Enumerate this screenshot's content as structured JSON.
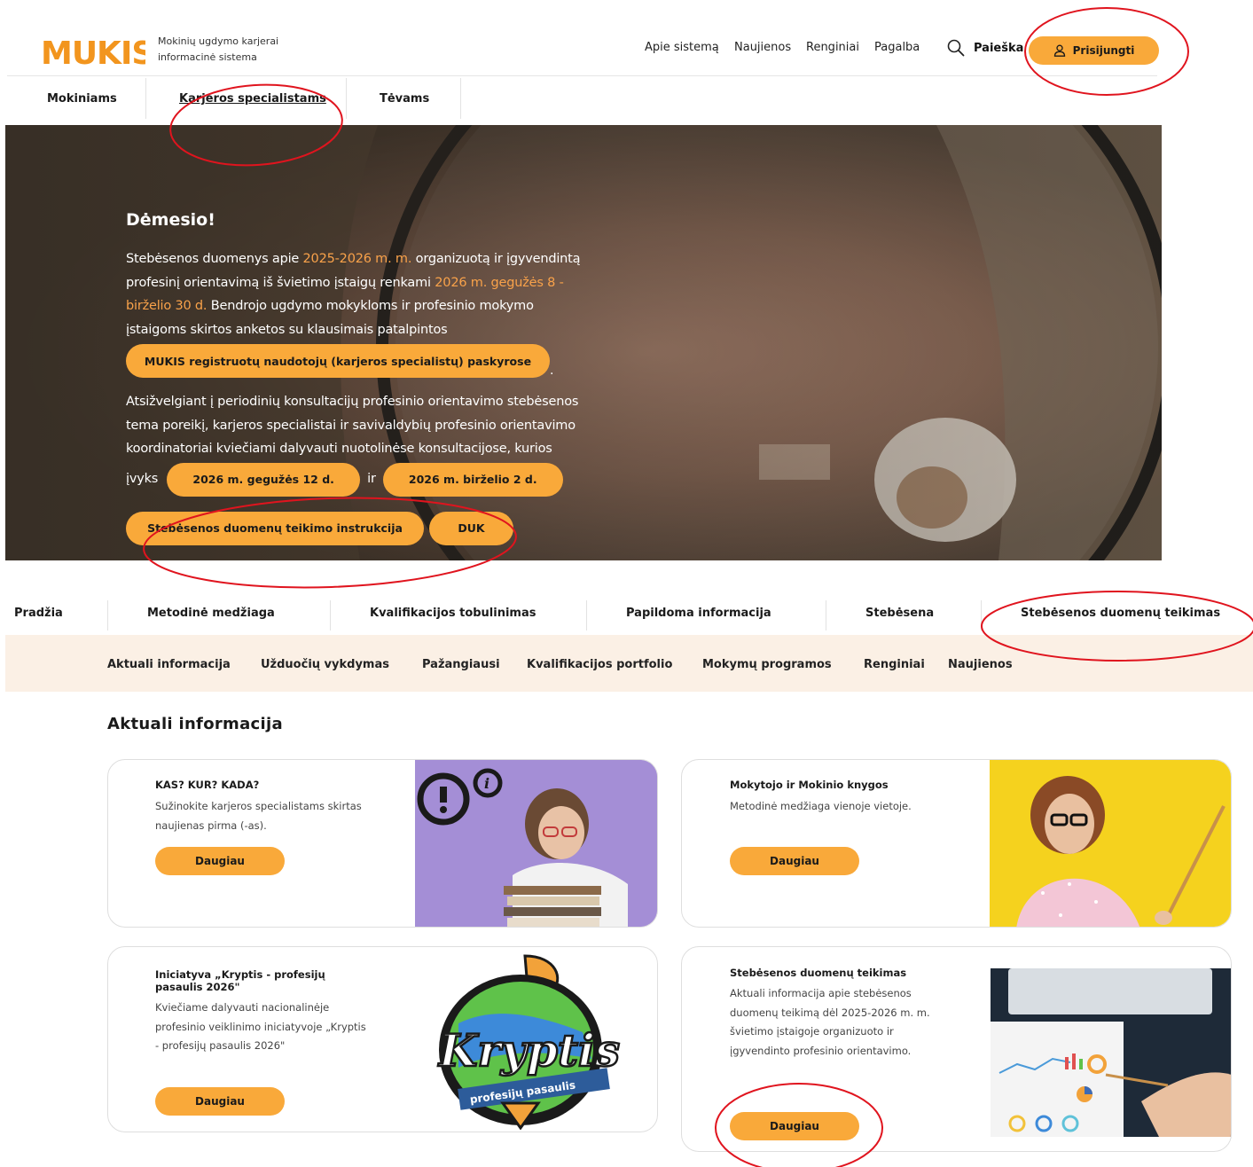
{
  "brand": {
    "logo_text": "MUKIS",
    "tagline_line1": "Mokinių ugdymo karjerai",
    "tagline_line2": "informacinė sistema"
  },
  "top_nav": [
    "Apie sistemą",
    "Naujienos",
    "Renginiai",
    "Pagalba"
  ],
  "search_label": "Paieška",
  "login_label": "Prisijungti",
  "audience_tabs": [
    "Mokiniams",
    "Karjeros specialistams",
    "Tėvams"
  ],
  "hero": {
    "title": "Dėmesio!",
    "p1_a": "Stebėsenos duomenys apie ",
    "p1_hl1": "2025-2026 m. m.",
    "p1_b": " organizuotą ir įgyvendintą profesinį orientavimą iš švietimo įstaigų renkami ",
    "p1_hl2": "2026 m. gegužės 8 - birželio 30 d.",
    "p1_c": " Bendrojo ugdymo mokykloms ir profesinio mokymo įstaigoms skirtos anketos su klausimais patalpintos",
    "pill_accounts": "MUKIS registruotų naudotojų (karjeros specialistų) paskyrose",
    "pill_accounts_after": ".",
    "p2": "Atsižvelgiant į periodinių konsultacijų profesinio orientavimo stebėsenos tema poreikį, karjeros specialistai ir savivaldybių profesinio orientavimo koordinatoriai kviečiami dalyvauti nuotolinėse konsultacijose, kurios",
    "p2_vyks": "įvyks",
    "date1": "2026 m. gegužės 12 d.",
    "ir": "ir",
    "date2": "2026 m. birželio 2 d.",
    "btn_instructions": "Stebėsenos duomenų teikimo instrukcija",
    "btn_faq": "DUK"
  },
  "main_nav": [
    "Pradžia",
    "Metodinė medžiaga",
    "Kvalifikacijos tobulinimas",
    "Papildoma informacija",
    "Stebėsena",
    "Stebėsenos duomenų teikimas"
  ],
  "sub_nav": [
    "Aktuali informacija",
    "Užduočių vykdymas",
    "Pažangiausi",
    "Kvalifikacijos portfolio",
    "Mokymų programos",
    "Renginiai",
    "Naujienos"
  ],
  "section_title": "Aktuali informacija",
  "cards": [
    {
      "title": "KAS? KUR? KADA?",
      "desc": "Sužinokite karjeros specialistams skirtas naujienas pirma (-as).",
      "button": "Daugiau"
    },
    {
      "title": "Mokytojo ir Mokinio knygos",
      "desc": "Metodinė medžiaga vienoje vietoje.",
      "button": "Daugiau"
    },
    {
      "title": "Iniciatyva „Kryptis - profesijų pasaulis 2026\"",
      "desc": "Kviečiame dalyvauti nacionalinėje profesinio veiklinimo iniciatyvoje „Kryptis - profesijų pasaulis 2026\"",
      "button": "Daugiau",
      "logo_big": "Kryptis",
      "logo_small": "profesijų pasaulis"
    },
    {
      "title": "Stebėsenos duomenų teikimas",
      "desc": "Aktuali informacija apie stebėsenos duomenų teikimą dėl 2025-2026 m. m. švietimo įstaigoje organizuoto ir įgyvendinto profesinio orientavimo.",
      "button": "Daugiau"
    }
  ],
  "colors": {
    "accent": "#f9a93a",
    "highlight": "#f9a24a",
    "annotation": "#e0141e",
    "subnav_bg": "#fbf0e5"
  },
  "icons": [
    "search-icon",
    "user-icon"
  ]
}
